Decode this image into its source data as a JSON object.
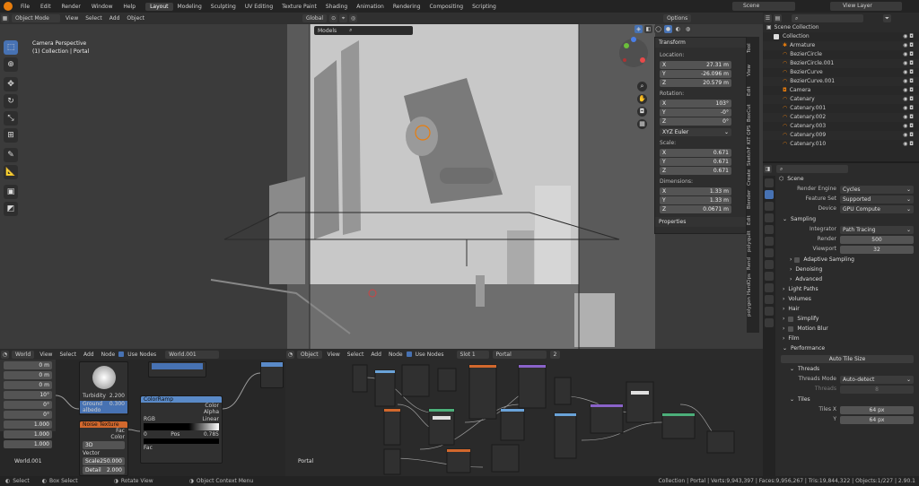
{
  "topbar": {
    "menus": [
      "File",
      "Edit",
      "Render",
      "Window",
      "Help"
    ],
    "workspaces": [
      "Layout",
      "Modeling",
      "Sculpting",
      "UV Editing",
      "Texture Paint",
      "Shading",
      "Animation",
      "Rendering",
      "Compositing",
      "Scripting"
    ],
    "active_workspace": "Layout",
    "scene": "Scene",
    "view_layer": "View Layer"
  },
  "viewport": {
    "mode": "Object Mode",
    "menus": [
      "View",
      "Select",
      "Add",
      "Object"
    ],
    "orientation": "Global",
    "options": "Options",
    "collection_dropdown": "Models",
    "camera_title": "Camera Perspective",
    "camera_sub": "(1) Collection | Portal"
  },
  "npanel": {
    "header": "Transform",
    "location_label": "Location:",
    "location": [
      [
        "X",
        "27.31 m"
      ],
      [
        "Y",
        "-26.096 m"
      ],
      [
        "Z",
        "20.579 m"
      ]
    ],
    "rotation_label": "Rotation:",
    "rotation": [
      [
        "X",
        "103°"
      ],
      [
        "Y",
        "-0°"
      ],
      [
        "Z",
        "0°"
      ]
    ],
    "rotation_mode": "XYZ Euler",
    "scale_label": "Scale:",
    "scale": [
      [
        "X",
        "0.671"
      ],
      [
        "Y",
        "0.671"
      ],
      [
        "Z",
        "0.671"
      ]
    ],
    "dimensions_label": "Dimensions:",
    "dimensions": [
      [
        "X",
        "1.33 m"
      ],
      [
        "Y",
        "1.33 m"
      ],
      [
        "Z",
        "0.0671 m"
      ]
    ],
    "properties": "Properties"
  },
  "side_tabs": [
    "Tool",
    "View",
    "Edit",
    "BoxCut",
    "KIT OPS",
    "SketchF",
    "Create",
    "Blender",
    "Edit",
    "polyquilt",
    "Rend",
    "HardOps",
    "polygon"
  ],
  "outliner": {
    "root": "Scene Collection",
    "items": [
      "Collection",
      "Armature",
      "BezierCircle",
      "BezierCircle.001",
      "BezierCurve",
      "BezierCurve.001",
      "Camera",
      "Catenary",
      "Catenary.001",
      "Catenary.002",
      "Catenary.003",
      "Catenary.009",
      "Catenary.010"
    ]
  },
  "properties": {
    "header": "Scene",
    "render_engine_label": "Render Engine",
    "render_engine": "Cycles",
    "feature_set_label": "Feature Set",
    "feature_set": "Supported",
    "device_label": "Device",
    "device": "GPU Compute",
    "sampling": "Sampling",
    "integrator_label": "Integrator",
    "integrator": "Path Tracing",
    "render_label": "Render",
    "render_val": "500",
    "viewport_label": "Viewport",
    "viewport_val": "32",
    "adaptive": "Adaptive Sampling",
    "denoising": "Denoising",
    "advanced": "Advanced",
    "light_paths": "Light Paths",
    "volumes": "Volumes",
    "hair": "Hair",
    "simplify": "Simplify",
    "motion_blur": "Motion Blur",
    "film": "Film",
    "performance": "Performance",
    "auto_tile": "Auto Tile Size",
    "threads": "Threads",
    "threads_mode_label": "Threads Mode",
    "threads_mode": "Auto-detect",
    "threads_label": "Threads",
    "threads_val": "8",
    "tiles": "Tiles",
    "tiles_x_label": "Tiles X",
    "tiles_x": "64 px",
    "tiles_y_label": "Y",
    "tiles_y": "64 px"
  },
  "node_left": {
    "type": "World",
    "menus": [
      "View",
      "Select",
      "Add",
      "Node"
    ],
    "use_nodes": "Use Nodes",
    "datablock": "World.001",
    "label": "World.001",
    "nodes": {
      "turbidity_label": "Turbidity",
      "turbidity": "2.200",
      "ground_label": "Ground albedo",
      "ground": "0.300",
      "colorramp": "ColorRamp",
      "color": "Color",
      "alpha": "Alpha",
      "fac": "Fac",
      "noise": "Noise Texture",
      "vector": "Vector",
      "scale": "Scale",
      "scale_val": "250.000",
      "detail": "Detail",
      "detail_val": "2.000",
      "dim": "3D",
      "rgb": "RGB",
      "linear": "Linear",
      "pos": "Pos",
      "pos_val": "0.785",
      "zero": "0",
      "rgb_out": "RGB",
      "fac_val": "1.000"
    },
    "values": [
      "0 m",
      "0 m",
      "0 m",
      "10°",
      "0°",
      "0°",
      "1.000",
      "1.000",
      "1.000"
    ]
  },
  "node_right": {
    "type": "Object",
    "menus": [
      "View",
      "Select",
      "Add",
      "Node"
    ],
    "use_nodes": "Use Nodes",
    "slot": "Slot 1",
    "material": "Portal",
    "users": "2",
    "label": "Portal"
  },
  "status": {
    "select": "Select",
    "box_select": "Box Select",
    "rotate": "Rotate View",
    "context": "Object Context Menu",
    "stats": "Collection | Portal | Verts:9,943,397 | Faces:9,956,267 | Tris:19,844,322 | Objects:1/227 | 2.90.1"
  },
  "colors": {
    "accent": "#4772b3",
    "orange": "#e87d0d",
    "panel": "#2b2b2b"
  }
}
